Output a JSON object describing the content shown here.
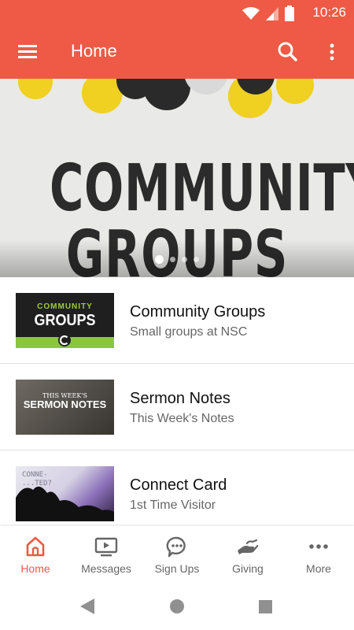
{
  "status_bar": {
    "time": "10:26"
  },
  "app_bar": {
    "title": "Home"
  },
  "hero": {
    "line1": "COMMUNITY",
    "line2": "GROUPS",
    "slide_count": 4,
    "active_slide": 1
  },
  "list": [
    {
      "title": "Community Groups",
      "subtitle": "Small groups at NSC",
      "thumb_small": "COMMUNITY",
      "thumb_big": "GROUPS"
    },
    {
      "title": "Sermon Notes",
      "subtitle": "This Week's Notes",
      "thumb_small": "THIS WEEK'S",
      "thumb_big": "SERMON NOTES"
    },
    {
      "title": "Connect Card",
      "subtitle": "1st Time Visitor",
      "thumb_text": "CONNE-\n...TED?"
    }
  ],
  "bottom_nav": [
    {
      "label": "Home",
      "icon": "home-icon"
    },
    {
      "label": "Messages",
      "icon": "tv-play-icon"
    },
    {
      "label": "Sign Ups",
      "icon": "chat-bubble-icon"
    },
    {
      "label": "Giving",
      "icon": "giving-hand-icon"
    },
    {
      "label": "More",
      "icon": "more-dots-icon"
    }
  ],
  "colors": {
    "primary": "#ee5a45",
    "hero_dot_yellow": "#f0d020",
    "hero_dot_black": "#2a2a2a",
    "community_groups_green": "#8cc63f"
  }
}
